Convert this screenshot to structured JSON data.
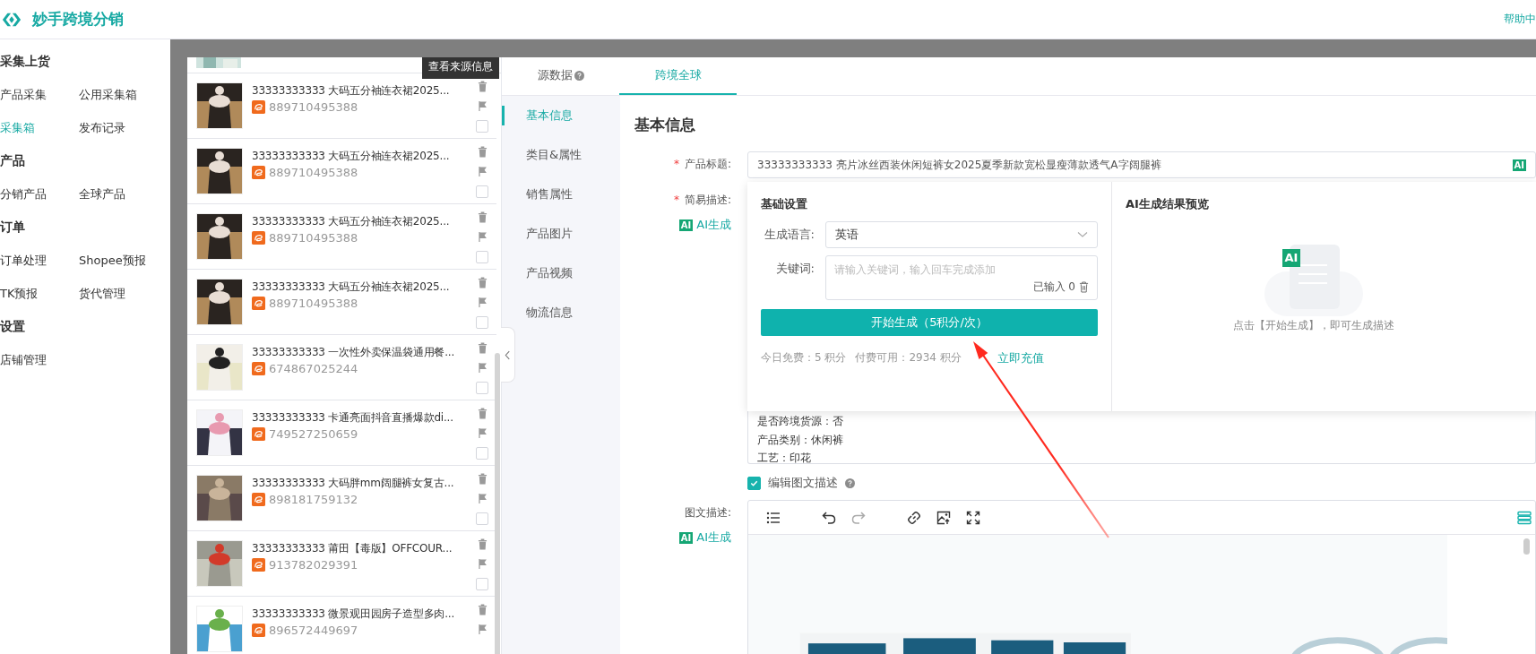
{
  "header": {
    "app_name": "妙手跨境分销",
    "help_link": "帮助中"
  },
  "sidebar": {
    "sections": [
      {
        "title": "采集上货",
        "items": [
          {
            "label": "产品采集",
            "selected": false
          },
          {
            "label": "公用采集箱",
            "selected": false
          },
          {
            "label": "采集箱",
            "selected": true
          },
          {
            "label": "发布记录",
            "selected": false
          }
        ]
      },
      {
        "title": "产品",
        "items": [
          {
            "label": "分销产品",
            "selected": false
          },
          {
            "label": "全球产品",
            "selected": false
          }
        ]
      },
      {
        "title": "订单",
        "items": [
          {
            "label": "订单处理",
            "selected": false
          },
          {
            "label": "Shopee预报",
            "selected": false
          },
          {
            "label": "TK预报",
            "selected": false
          },
          {
            "label": "货代管理",
            "selected": false
          }
        ]
      },
      {
        "title": "设置",
        "items": [
          {
            "label": "店铺管理",
            "selected": false
          }
        ]
      }
    ]
  },
  "product_list": {
    "tooltip": "查看来源信息",
    "items": [
      {
        "title": "33333333333 大码五分袖连衣裙2025...",
        "id": "889710495388",
        "checked": false
      },
      {
        "title": "33333333333 大码五分袖连衣裙2025...",
        "id": "889710495388",
        "checked": false
      },
      {
        "title": "33333333333 大码五分袖连衣裙2025...",
        "id": "889710495388",
        "checked": false
      },
      {
        "title": "33333333333 大码五分袖连衣裙2025...",
        "id": "889710495388",
        "checked": false
      },
      {
        "title": "33333333333 一次性外卖保温袋通用餐...",
        "id": "674867025244",
        "checked": false
      },
      {
        "title": "33333333333 卡通亮面抖音直播爆款di...",
        "id": "749527250659",
        "checked": false
      },
      {
        "title": "33333333333 大码胖mm阔腿裤女复古...",
        "id": "898181759132",
        "checked": false
      },
      {
        "title": "33333333333 莆田【毒版】OFFCOUR...",
        "id": "913782029391",
        "checked": false
      },
      {
        "title": "33333333333 微景观田园房子造型多肉...",
        "id": "896572449697"
      }
    ]
  },
  "tabs": [
    {
      "label": "源数据",
      "help": true,
      "selected": false
    },
    {
      "label": "跨境全球",
      "selected": true
    }
  ],
  "section_nav": [
    {
      "label": "基本信息",
      "selected": true
    },
    {
      "label": "类目&属性",
      "selected": false
    },
    {
      "label": "销售属性",
      "selected": false
    },
    {
      "label": "产品图片",
      "selected": false
    },
    {
      "label": "产品视频",
      "selected": false
    },
    {
      "label": "物流信息",
      "selected": false
    }
  ],
  "form": {
    "heading": "基本信息",
    "title_field": {
      "label": "产品标题:",
      "required_mark": "*",
      "value": "33333333333 亮片冰丝西装休闲短裤女2025夏季新款宽松显瘦薄款透气A字阔腿裤",
      "ai_badge": "AI"
    },
    "description": {
      "label": "简易描述:",
      "required_mark": "*",
      "ai_badge": "AI",
      "ai_button": "AI生成",
      "lines": [
        "是否跨境货源：否",
        "产品类别：休闲裤",
        "工艺：印花"
      ]
    },
    "rich_toggle": {
      "label": "编辑图文描述",
      "checked": true
    },
    "rich_description": {
      "label": "图文描述:",
      "ai_badge": "AI",
      "ai_button": "AI生成",
      "redo_disabled": true
    }
  },
  "ai_popup": {
    "settings_title": "基础设置",
    "language_label": "生成语言:",
    "language_value": "英语",
    "keywords_label": "关键词:",
    "keywords_placeholder": "请输入关键词，输入回车完成添加",
    "keywords_count": "已输入 0",
    "generate_button": "开始生成（5积分/次）",
    "free_today": "今日免费：5 积分",
    "paid_available": "付费可用：2934 积分",
    "recharge_link": "立即充值",
    "preview_title": "AI生成结果预览",
    "preview_badge": "AI",
    "preview_hint": "点击【开始生成】，即可生成描述"
  }
}
